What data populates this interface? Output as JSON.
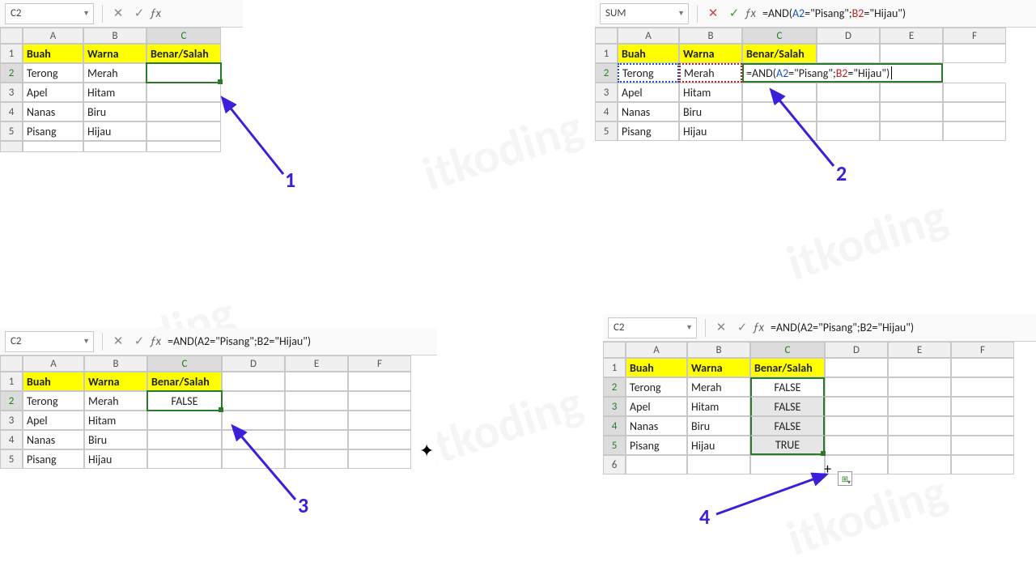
{
  "watermark": "itkoding",
  "labels": {
    "l1": "1",
    "l2": "2",
    "l3": "3",
    "l4": "4"
  },
  "headers": {
    "A": "Buah",
    "B": "Warna",
    "C": "Benar/Salah"
  },
  "cols": [
    "A",
    "B",
    "C",
    "D",
    "E",
    "F"
  ],
  "rows": [
    "1",
    "2",
    "3",
    "4",
    "5",
    "6"
  ],
  "data_rows": [
    {
      "A": "Terong",
      "B": "Merah"
    },
    {
      "A": "Apel",
      "B": "Hitam"
    },
    {
      "A": "Nanas",
      "B": "Biru"
    },
    {
      "A": "Pisang",
      "B": "Hijau"
    }
  ],
  "formula_plain": "=AND(A2=\"Pisang\";B2=\"Hijau\")",
  "formula_parts": {
    "pre": "=AND(",
    "a": "A2",
    "mid1": "=\"Pisang\";",
    "b": "B2",
    "mid2": "=\"Hijau\")"
  },
  "p1": {
    "namebox": "C2"
  },
  "p2": {
    "namebox": "SUM"
  },
  "p3": {
    "namebox": "C2",
    "c2": "FALSE"
  },
  "p4": {
    "namebox": "C2",
    "results": {
      "c2": "FALSE",
      "c3": "FALSE",
      "c4": "FALSE",
      "c5": "TRUE"
    }
  },
  "icons": {
    "cancel": "✕",
    "ok": "✓",
    "fill": "⊞"
  }
}
